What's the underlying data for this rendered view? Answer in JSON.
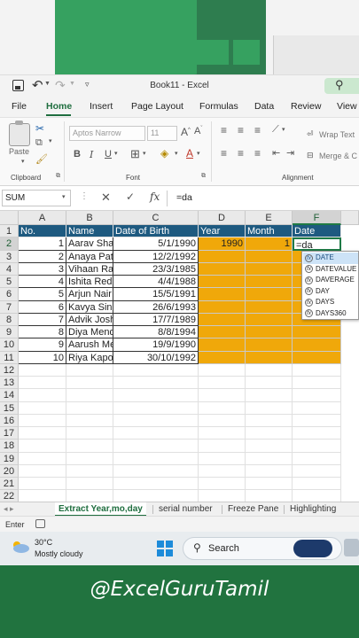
{
  "window": {
    "title": "Book11 - Excel"
  },
  "quick_access": {
    "save": "save-icon",
    "undo": "undo-icon",
    "redo": "redo-icon"
  },
  "ribbon_tabs": [
    "File",
    "Home",
    "Insert",
    "Page Layout",
    "Formulas",
    "Data",
    "Review",
    "View"
  ],
  "ribbon": {
    "paste_label": "Paste",
    "font_name": "Aptos Narrow",
    "font_size": "11",
    "wrap_text": "Wrap Text",
    "merge": "Merge & C",
    "groups": {
      "clipboard": "Clipboard",
      "font": "Font",
      "alignment": "Alignment"
    }
  },
  "formula_bar": {
    "name_box": "SUM",
    "cancel": "✕",
    "enter": "✓",
    "fx": "fx",
    "value": "=da"
  },
  "columns": [
    "A",
    "B",
    "C",
    "D",
    "E",
    "F"
  ],
  "rows": [
    "1",
    "2",
    "3",
    "4",
    "5",
    "6",
    "7",
    "8",
    "9",
    "10",
    "11",
    "12",
    "13",
    "14",
    "15",
    "16",
    "17",
    "18",
    "19",
    "20",
    "21",
    "22"
  ],
  "table": {
    "headers": [
      "No.",
      "Name",
      "Date of Birth",
      "Year",
      "Month",
      "Date"
    ],
    "data": [
      [
        "1",
        "Aarav Sha",
        "5/1/1990",
        "1990",
        "1",
        "=da"
      ],
      [
        "2",
        "Anaya Pat",
        "12/2/1992",
        "",
        "",
        ""
      ],
      [
        "3",
        "Vihaan Ra",
        "23/3/1985",
        "",
        "",
        ""
      ],
      [
        "4",
        "Ishita Red",
        "4/4/1988",
        "",
        "",
        ""
      ],
      [
        "5",
        "Arjun Nair",
        "15/5/1991",
        "",
        "",
        ""
      ],
      [
        "6",
        "Kavya Sin",
        "26/6/1993",
        "",
        "",
        ""
      ],
      [
        "7",
        "Advik Josh",
        "17/7/1989",
        "",
        "",
        ""
      ],
      [
        "8",
        "Diya Mend",
        "8/8/1994",
        "",
        "",
        ""
      ],
      [
        "9",
        "Aarush Me",
        "19/9/1990",
        "",
        "",
        ""
      ],
      [
        "10",
        "Riya Kapo",
        "30/10/1992",
        "",
        "",
        ""
      ]
    ]
  },
  "autocomplete": [
    "DATE",
    "DATEVALUE",
    "DAVERAGE",
    "DAY",
    "DAYS",
    "DAYS360"
  ],
  "sheet_tabs": [
    "Extract Year,mo,day",
    "serial number",
    "Freeze Pane",
    "Highlighting"
  ],
  "status": {
    "mode": "Enter"
  },
  "taskbar": {
    "temp": "30°C",
    "weather": "Mostly cloudy",
    "search": "Search"
  },
  "watermark": "@ExcelGuruTamil",
  "colors": {
    "excel_green": "#21733f",
    "header_blue": "#1e5a80",
    "highlight_orange": "#f0a80a"
  }
}
